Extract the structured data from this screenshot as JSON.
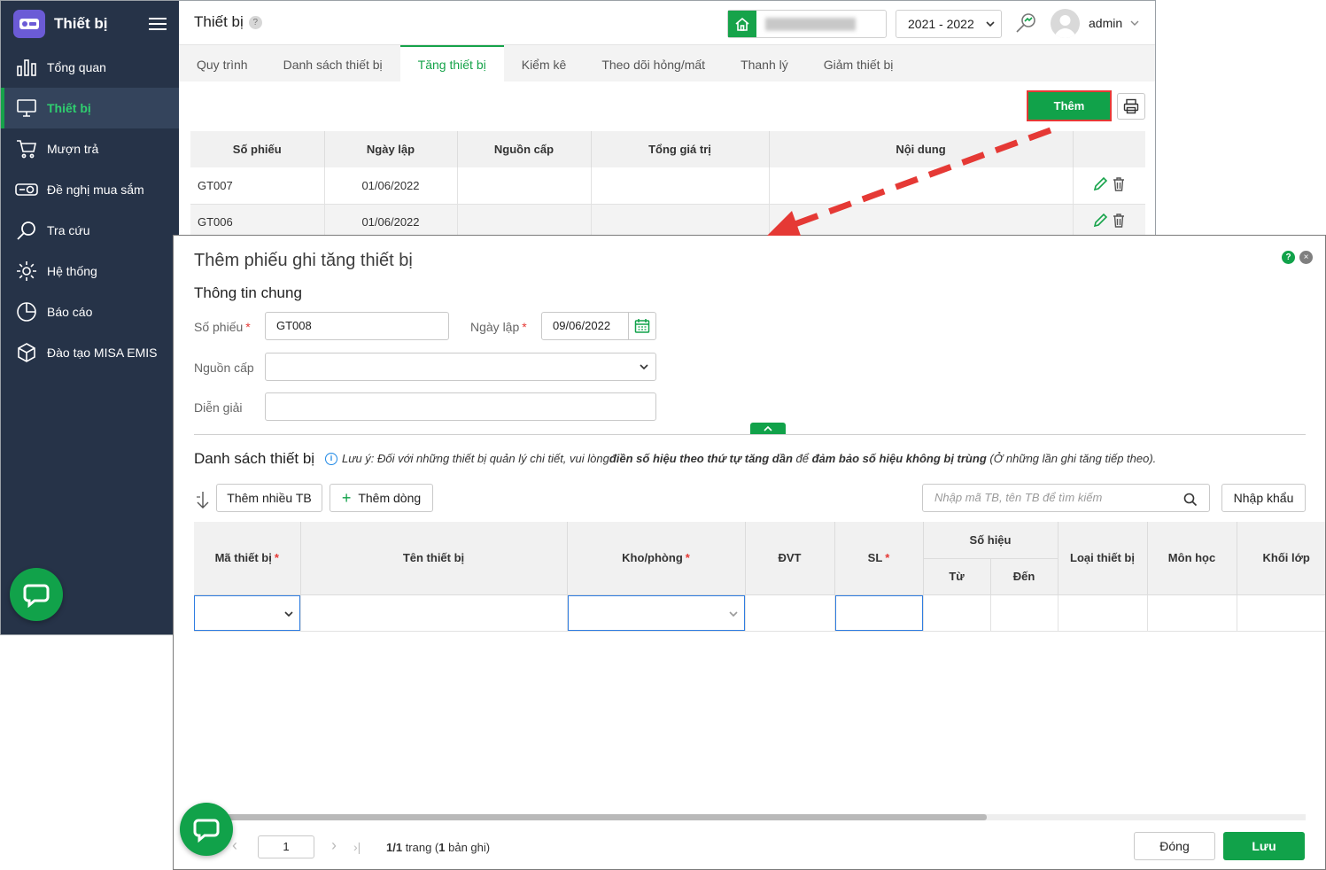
{
  "sidebar": {
    "title": "Thiết bị",
    "items": [
      {
        "label": "Tổng quan",
        "icon": "chart-bars-icon"
      },
      {
        "label": "Thiết bị",
        "icon": "monitor-icon",
        "active": true
      },
      {
        "label": "Mượn trả",
        "icon": "cart-icon"
      },
      {
        "label": "Đề nghị mua sắm",
        "icon": "projector-icon"
      },
      {
        "label": "Tra cứu",
        "icon": "search-icon"
      },
      {
        "label": "Hệ thống",
        "icon": "gear-icon"
      },
      {
        "label": "Báo cáo",
        "icon": "pie-chart-icon"
      },
      {
        "label": "Đào tạo MISA EMIS",
        "icon": "cube-icon"
      }
    ]
  },
  "header": {
    "page_title": "Thiết bị",
    "help": "?",
    "school_year": "2021 - 2022",
    "username": "admin"
  },
  "tabs": [
    {
      "label": "Quy trình"
    },
    {
      "label": "Danh sách thiết bị"
    },
    {
      "label": "Tăng thiết bị",
      "active": true
    },
    {
      "label": "Kiểm kê"
    },
    {
      "label": "Theo dõi hỏng/mất"
    },
    {
      "label": "Thanh lý"
    },
    {
      "label": "Giảm thiết bị"
    }
  ],
  "toolbar": {
    "add_label": "Thêm"
  },
  "grid": {
    "columns": [
      "Số phiếu",
      "Ngày lập",
      "Nguồn cấp",
      "Tổng giá trị",
      "Nội dung",
      ""
    ],
    "rows": [
      {
        "so_phieu": "GT007",
        "ngay_lap": "01/06/2022",
        "nguon_cap": "",
        "tong_gia_tri": "",
        "noi_dung": ""
      },
      {
        "so_phieu": "GT006",
        "ngay_lap": "01/06/2022",
        "nguon_cap": "",
        "tong_gia_tri": "",
        "noi_dung": ""
      }
    ]
  },
  "modal": {
    "title": "Thêm phiếu ghi tăng thiết bị",
    "help": "?",
    "close": "×",
    "general_section": "Thông tin chung",
    "fields": {
      "so_phieu_label": "Số phiếu",
      "so_phieu_value": "GT008",
      "ngay_lap_label": "Ngày lập",
      "ngay_lap_value": "09/06/2022",
      "nguon_cap_label": "Nguồn cấp",
      "nguon_cap_value": "",
      "dien_giai_label": "Diễn giải",
      "dien_giai_value": "",
      "required_mark": "*"
    },
    "list_section": "Danh sách thiết bị",
    "note": {
      "prefix": "Lưu ý: Đối với những thiết bị quản lý chi tiết, vui lòng ",
      "bold1": "điền số hiệu theo thứ tự tăng dần",
      "middle": " để ",
      "bold2": "đảm bảo số hiệu không bị trùng",
      "suffix": " (Ở những lần ghi tăng tiếp theo)."
    },
    "buttons": {
      "add_many": "Thêm nhiều TB",
      "add_row": "Thêm dòng",
      "import": "Nhập khẩu",
      "close": "Đóng",
      "save": "Lưu"
    },
    "search_placeholder": "Nhập mã TB, tên TB để tìm kiếm",
    "columns": {
      "ma_thiet_bi": "Mã thiết bị",
      "ten_thiet_bi": "Tên thiết bị",
      "kho_phong": "Kho/phòng",
      "dvt": "ĐVT",
      "sl": "SL",
      "so_hieu": "Số hiệu",
      "tu": "Từ",
      "den": "Đến",
      "loai_thiet_bi": "Loại thiết bị",
      "mon_hoc": "Môn học",
      "khoi_lop": "Khối lớp"
    },
    "pager": {
      "page": "1",
      "info_page": "1/1",
      "info_trang": " trang (",
      "info_count": "1",
      "info_suffix": " bản ghi)"
    }
  },
  "colors": {
    "sidebar_bg": "#263348",
    "accent_green": "#11a24a",
    "highlight_red": "#e53935"
  }
}
